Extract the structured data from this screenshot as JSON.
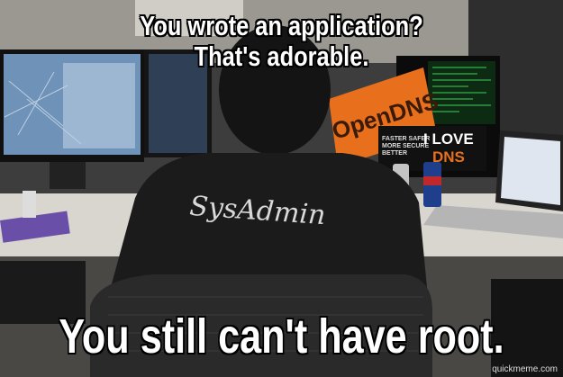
{
  "meme": {
    "top_line_1": "You wrote an application?",
    "top_line_2": "That's adorable.",
    "bottom_text": "You still can't have root.",
    "watermark": "quickmeme.com"
  },
  "scene": {
    "shirt_text": "SysAdmin",
    "poster_brand": "OpenDNS",
    "poster_tagline_1": "FASTER SAFER",
    "poster_tagline_2": "MORE SECURE",
    "poster_tagline_3": "BETTER",
    "poster_love": "I LOVE",
    "poster_dns": "DNS",
    "colors": {
      "poster_orange": "#e8701c",
      "shirt": "#1b1b1b",
      "desk": "#d9d6cf"
    }
  }
}
